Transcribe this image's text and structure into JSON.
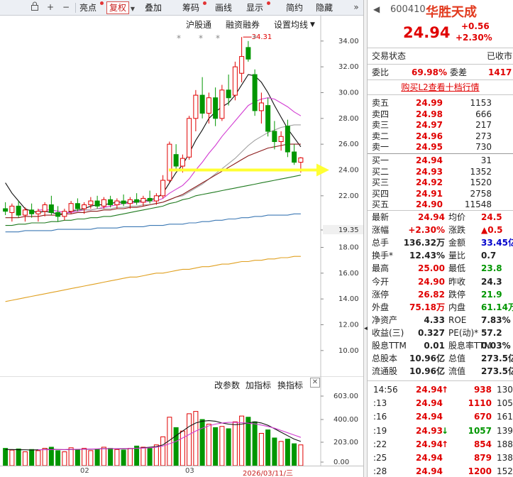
{
  "toolbar": {
    "icons": [
      "lock-icon",
      "plus-icon",
      "minus-icon"
    ],
    "items": [
      {
        "label": "亮点",
        "dot": true,
        "active": false
      },
      {
        "label": "复权",
        "dot": false,
        "active": true
      },
      {
        "label": "叠加",
        "dot": false,
        "active": false
      },
      {
        "label": "筹码",
        "dot": true,
        "active": false
      },
      {
        "label": "画线",
        "dot": false,
        "active": false
      },
      {
        "label": "显示",
        "dot": true,
        "active": false
      },
      {
        "label": "简约",
        "dot": false,
        "active": false
      },
      {
        "label": "隐藏",
        "dot": false,
        "active": false
      }
    ],
    "more_icon": "double-chevron-right-icon"
  },
  "chart_links": {
    "hgt": "沪股通",
    "rzrq": "融资融券",
    "ma_settings": "设置均线"
  },
  "chart_data": [
    {
      "type": "candlestick",
      "title": "",
      "y_ticks": [
        10.0,
        12.0,
        14.0,
        16.0,
        18.0,
        19.35,
        22.0,
        24.0,
        26.0,
        28.0,
        30.0,
        32.0,
        34.0
      ],
      "y_tick_labels": [
        "10.00",
        "12.00",
        "14.00",
        "16.00",
        "18.00",
        "19.35",
        "22.00",
        "24.00",
        "26.00",
        "28.00",
        "30.00",
        "32.00",
        "34.00"
      ],
      "ylim": [
        9.0,
        35.2
      ],
      "high_annotation": "34.31",
      "star_marks": "*",
      "arrow_marker_price": 24.0,
      "candles": [
        {
          "o": 21.0,
          "h": 21.5,
          "l": 20.5,
          "c": 20.8
        },
        {
          "o": 20.7,
          "h": 21.4,
          "l": 20.0,
          "c": 21.2
        },
        {
          "o": 21.2,
          "h": 21.6,
          "l": 20.3,
          "c": 20.5
        },
        {
          "o": 20.5,
          "h": 21.1,
          "l": 20.0,
          "c": 20.9
        },
        {
          "o": 20.9,
          "h": 21.4,
          "l": 20.3,
          "c": 20.6
        },
        {
          "o": 20.6,
          "h": 21.0,
          "l": 20.0,
          "c": 20.8
        },
        {
          "o": 20.8,
          "h": 21.5,
          "l": 20.4,
          "c": 21.3
        },
        {
          "o": 21.3,
          "h": 22.0,
          "l": 20.5,
          "c": 20.7
        },
        {
          "o": 20.7,
          "h": 21.2,
          "l": 20.0,
          "c": 20.4
        },
        {
          "o": 20.4,
          "h": 21.0,
          "l": 20.1,
          "c": 20.8
        },
        {
          "o": 20.8,
          "h": 21.6,
          "l": 20.6,
          "c": 21.4
        },
        {
          "o": 21.4,
          "h": 21.8,
          "l": 20.8,
          "c": 21.0
        },
        {
          "o": 21.0,
          "h": 21.5,
          "l": 20.6,
          "c": 21.3
        },
        {
          "o": 21.3,
          "h": 21.9,
          "l": 21.0,
          "c": 21.6
        },
        {
          "o": 21.6,
          "h": 22.0,
          "l": 21.0,
          "c": 21.2
        },
        {
          "o": 21.2,
          "h": 21.9,
          "l": 21.0,
          "c": 21.7
        },
        {
          "o": 21.7,
          "h": 22.0,
          "l": 21.1,
          "c": 21.3
        },
        {
          "o": 21.3,
          "h": 21.8,
          "l": 21.0,
          "c": 21.6
        },
        {
          "o": 21.6,
          "h": 22.1,
          "l": 21.2,
          "c": 21.4
        },
        {
          "o": 21.4,
          "h": 21.9,
          "l": 21.0,
          "c": 21.7
        },
        {
          "o": 21.7,
          "h": 22.2,
          "l": 21.3,
          "c": 21.5
        },
        {
          "o": 21.5,
          "h": 22.0,
          "l": 21.2,
          "c": 21.8
        },
        {
          "o": 21.8,
          "h": 22.4,
          "l": 21.4,
          "c": 21.6
        },
        {
          "o": 21.6,
          "h": 22.2,
          "l": 21.3,
          "c": 22.0
        },
        {
          "o": 22.0,
          "h": 23.6,
          "l": 21.8,
          "c": 23.2
        },
        {
          "o": 23.2,
          "h": 26.2,
          "l": 23.0,
          "c": 26.0
        },
        {
          "o": 25.2,
          "h": 26.0,
          "l": 24.0,
          "c": 24.3
        },
        {
          "o": 24.3,
          "h": 25.2,
          "l": 23.8,
          "c": 24.9
        },
        {
          "o": 25.0,
          "h": 28.2,
          "l": 24.8,
          "c": 28.0
        },
        {
          "o": 28.0,
          "h": 30.2,
          "l": 27.0,
          "c": 29.8
        },
        {
          "o": 29.8,
          "h": 31.2,
          "l": 28.0,
          "c": 28.4
        },
        {
          "o": 28.4,
          "h": 30.0,
          "l": 27.6,
          "c": 29.6
        },
        {
          "o": 29.6,
          "h": 30.4,
          "l": 27.4,
          "c": 28.0
        },
        {
          "o": 28.0,
          "h": 30.6,
          "l": 27.8,
          "c": 30.2
        },
        {
          "o": 30.2,
          "h": 31.4,
          "l": 29.0,
          "c": 29.6
        },
        {
          "o": 29.8,
          "h": 32.4,
          "l": 29.4,
          "c": 32.0
        },
        {
          "o": 31.5,
          "h": 34.31,
          "l": 30.8,
          "c": 32.8
        },
        {
          "o": 33.5,
          "h": 34.0,
          "l": 32.4,
          "c": 32.6
        },
        {
          "o": 31.4,
          "h": 31.8,
          "l": 28.2,
          "c": 28.6
        },
        {
          "o": 28.6,
          "h": 30.0,
          "l": 27.6,
          "c": 29.2
        },
        {
          "o": 29.0,
          "h": 29.6,
          "l": 26.6,
          "c": 27.0
        },
        {
          "o": 27.0,
          "h": 27.8,
          "l": 25.6,
          "c": 26.2
        },
        {
          "o": 26.2,
          "h": 27.0,
          "l": 25.5,
          "c": 26.6
        },
        {
          "o": 27.4,
          "h": 27.9,
          "l": 25.0,
          "c": 25.4
        },
        {
          "o": 25.4,
          "h": 26.0,
          "l": 24.4,
          "c": 24.6
        },
        {
          "o": 24.6,
          "h": 25.0,
          "l": 23.8,
          "c": 24.94
        }
      ],
      "ma_lines": [
        {
          "color": "#111111",
          "values": [
            23.0,
            22.2,
            21.6,
            21.0,
            20.8,
            20.7,
            20.8,
            20.7,
            20.6,
            20.6,
            20.8,
            20.9,
            21.0,
            21.2,
            21.3,
            21.3,
            21.4,
            21.5,
            21.5,
            21.5,
            21.6,
            21.6,
            21.7,
            21.8,
            22.2,
            23.0,
            23.8,
            24.4,
            25.3,
            26.3,
            27.1,
            28.0,
            28.5,
            28.9,
            29.2,
            29.8,
            30.6,
            31.4,
            31.3,
            30.8,
            30.0,
            29.0,
            28.1,
            27.2,
            26.5,
            25.8
          ]
        },
        {
          "color": "#d23cd2",
          "values": [
            null,
            null,
            null,
            null,
            null,
            20.9,
            20.9,
            20.9,
            20.8,
            20.7,
            20.7,
            20.8,
            20.9,
            20.9,
            21.0,
            21.1,
            21.2,
            21.3,
            21.4,
            21.4,
            21.5,
            21.5,
            21.6,
            21.6,
            21.8,
            22.2,
            22.5,
            22.8,
            23.3,
            24.0,
            24.6,
            25.3,
            25.9,
            26.6,
            27.2,
            27.8,
            28.4,
            29.0,
            29.3,
            29.5,
            29.6,
            29.5,
            29.2,
            28.9,
            28.5,
            28.2
          ]
        },
        {
          "color": "#a0a0a0",
          "values": [
            null,
            null,
            null,
            null,
            null,
            null,
            null,
            null,
            null,
            null,
            20.9,
            20.9,
            20.9,
            20.9,
            21.0,
            21.0,
            21.0,
            21.1,
            21.1,
            21.2,
            21.2,
            21.3,
            21.3,
            21.4,
            21.5,
            21.7,
            21.9,
            22.0,
            22.3,
            22.6,
            22.9,
            23.3,
            23.7,
            24.1,
            24.5,
            24.9,
            25.4,
            25.9,
            26.3,
            26.6,
            26.9,
            27.1,
            27.3,
            27.4,
            27.5,
            27.5
          ]
        },
        {
          "color": "#8b1a1a",
          "values": [
            20.3,
            20.3,
            20.3,
            20.4,
            20.4,
            20.4,
            20.5,
            20.5,
            20.5,
            20.6,
            20.6,
            20.7,
            20.7,
            20.8,
            20.8,
            20.9,
            20.9,
            21.0,
            21.0,
            21.1,
            21.1,
            21.2,
            21.3,
            21.4,
            21.5,
            21.7,
            21.9,
            22.1,
            22.4,
            22.7,
            23.0,
            23.3,
            23.6,
            23.9,
            24.2,
            24.5,
            24.8,
            25.1,
            25.3,
            25.5,
            25.7,
            25.8,
            25.9,
            26.0,
            26.0,
            26.0
          ]
        },
        {
          "color": "#1f7a1f",
          "values": [
            19.7,
            19.7,
            19.8,
            19.8,
            19.9,
            19.9,
            19.9,
            20.0,
            20.0,
            20.1,
            20.1,
            20.2,
            20.2,
            20.3,
            20.3,
            20.4,
            20.4,
            20.5,
            20.6,
            20.7,
            20.8,
            20.9,
            21.0,
            21.1,
            21.2,
            21.4,
            21.5,
            21.7,
            21.8,
            22.0,
            22.1,
            22.2,
            22.3,
            22.4,
            22.5,
            22.6,
            22.7,
            22.8,
            22.9,
            23.0,
            23.1,
            23.2,
            23.3,
            23.4,
            23.5,
            23.6
          ]
        },
        {
          "color": "#3c78b4",
          "values": [
            19.2,
            19.2,
            19.2,
            19.3,
            19.3,
            19.3,
            19.3,
            19.3,
            19.4,
            19.4,
            19.4,
            19.4,
            19.4,
            19.4,
            19.5,
            19.5,
            19.5,
            19.5,
            19.6,
            19.6,
            19.6,
            19.6,
            19.7,
            19.7,
            19.7,
            19.8,
            19.8,
            19.8,
            19.9,
            19.9,
            20.0,
            20.0,
            20.1,
            20.1,
            20.2,
            20.2,
            20.3,
            20.3,
            20.4,
            20.4,
            20.5,
            20.5,
            20.5,
            20.5,
            20.6,
            20.6
          ]
        },
        {
          "color": "#e0a020",
          "values": [
            13.8,
            13.9,
            14.0,
            14.1,
            14.2,
            14.3,
            14.4,
            14.5,
            14.6,
            14.7,
            14.8,
            14.9,
            15.0,
            15.1,
            15.2,
            15.3,
            15.4,
            15.5,
            15.6,
            15.7,
            15.7,
            15.8,
            15.9,
            16.0,
            16.0,
            16.1,
            16.2,
            16.3,
            16.3,
            16.4,
            16.5,
            16.5,
            16.6,
            16.7,
            16.7,
            16.8,
            16.9,
            16.9,
            17.0,
            17.0,
            17.1,
            17.1,
            17.2,
            17.2,
            17.3,
            17.3
          ]
        }
      ]
    },
    {
      "type": "bar",
      "title": "",
      "y_tick_labels": [
        "603.00",
        "400.00",
        "203.00",
        "0.00"
      ],
      "y_ticks": [
        603,
        400,
        203,
        0
      ],
      "ylim": [
        0,
        640
      ],
      "values": [
        150,
        135,
        145,
        120,
        140,
        130,
        150,
        160,
        130,
        120,
        155,
        140,
        150,
        130,
        145,
        160,
        150,
        140,
        135,
        150,
        170,
        160,
        150,
        180,
        250,
        420,
        330,
        300,
        450,
        470,
        400,
        360,
        330,
        340,
        320,
        380,
        430,
        420,
        380,
        280,
        310,
        240,
        210,
        230,
        190,
        180
      ],
      "ma_lines": [
        {
          "color": "#111111",
          "values": [
            140,
            140,
            138,
            137,
            136,
            137,
            140,
            142,
            140,
            138,
            140,
            141,
            142,
            143,
            144,
            147,
            148,
            146,
            145,
            147,
            150,
            155,
            160,
            165,
            180,
            220,
            260,
            300,
            340,
            370,
            385,
            390,
            385,
            370,
            360,
            355,
            360,
            370,
            380,
            370,
            350,
            320,
            290,
            260,
            230,
            210
          ]
        },
        {
          "color": "#d23cd2",
          "values": [
            null,
            null,
            null,
            null,
            null,
            138,
            138,
            139,
            140,
            140,
            141,
            142,
            143,
            144,
            145,
            146,
            147,
            147,
            148,
            149,
            150,
            152,
            155,
            160,
            170,
            190,
            210,
            240,
            270,
            300,
            325,
            345,
            360,
            370,
            375,
            375,
            372,
            368,
            362,
            352,
            340,
            325,
            305,
            285,
            265,
            245
          ]
        }
      ],
      "indicator_buttons": [
        "改参数",
        "加指标",
        "换指标"
      ]
    }
  ],
  "x_axis": {
    "labels": [
      "02",
      "03",
      "2026/03/11/三"
    ]
  },
  "quote": {
    "code": "600410",
    "name": "华胜天成",
    "price": "24.94",
    "change": "+0.56",
    "change_pct": "+2.30%",
    "status_label": "交易状态",
    "status_value": "已收市",
    "weibi_label": "委比",
    "weibi_value": "69.98%",
    "weicha_label": "委差",
    "weicha_value": "1417",
    "l2_link": "购买L2查看十档行情",
    "asks": [
      {
        "label": "卖五",
        "price": "24.99",
        "vol": "1153"
      },
      {
        "label": "卖四",
        "price": "24.98",
        "vol": "666"
      },
      {
        "label": "卖三",
        "price": "24.97",
        "vol": "217"
      },
      {
        "label": "卖二",
        "price": "24.96",
        "vol": "273"
      },
      {
        "label": "卖一",
        "price": "24.95",
        "vol": "730"
      }
    ],
    "bids": [
      {
        "label": "买一",
        "price": "24.94",
        "vol": "31"
      },
      {
        "label": "买二",
        "price": "24.93",
        "vol": "1352"
      },
      {
        "label": "买三",
        "price": "24.92",
        "vol": "1520"
      },
      {
        "label": "买四",
        "price": "24.91",
        "vol": "2758"
      },
      {
        "label": "买五",
        "price": "24.90",
        "vol": "11548"
      }
    ],
    "stats": [
      {
        "l1": "最新",
        "v1": "24.94",
        "c1": "red",
        "l2": "均价",
        "v2": "24.5",
        "c2": "red"
      },
      {
        "l1": "涨幅",
        "v1": "+2.30%",
        "c1": "red",
        "l2": "涨跌",
        "v2": "▲0.5",
        "c2": "red"
      },
      {
        "l1": "总手",
        "v1": "136.32万",
        "c1": "black",
        "l2": "金额",
        "v2": "33.45亿",
        "c2": "blue"
      },
      {
        "l1": "换手*",
        "v1": "12.43%",
        "c1": "black",
        "l2": "量比",
        "v2": "0.7",
        "c2": "black"
      },
      {
        "l1": "最高",
        "v1": "25.00",
        "c1": "red",
        "l2": "最低",
        "v2": "23.8",
        "c2": "green"
      },
      {
        "l1": "今开",
        "v1": "24.90",
        "c1": "red",
        "l2": "昨收",
        "v2": "24.3",
        "c2": "black"
      },
      {
        "l1": "涨停",
        "v1": "26.82",
        "c1": "red",
        "l2": "跌停",
        "v2": "21.9",
        "c2": "green"
      },
      {
        "l1": "外盘",
        "v1": "75.18万",
        "c1": "red",
        "l2": "内盘",
        "v2": "61.14万",
        "c2": "green"
      },
      {
        "l1": "净资产",
        "v1": "4.33",
        "c1": "black",
        "l2": "ROE",
        "v2": "7.83%",
        "c2": "black"
      },
      {
        "l1": "收益(三)",
        "v1": "0.327",
        "c1": "black",
        "l2": "PE(动)*",
        "v2": "57.2",
        "c2": "black"
      },
      {
        "l1": "股息TTM",
        "v1": "0.01",
        "c1": "black",
        "l2": "股息率TTM",
        "v2": "0.03%",
        "c2": "black"
      },
      {
        "l1": "总股本",
        "v1": "10.96亿",
        "c1": "black",
        "l2": "总值",
        "v2": "273.5亿",
        "c2": "black"
      },
      {
        "l1": "流通股",
        "v1": "10.96亿",
        "c1": "black",
        "l2": "流值",
        "v2": "273.5亿",
        "c2": "black"
      }
    ],
    "ticks": [
      {
        "time": "14:56",
        "price": "24.94",
        "dir": "up",
        "vol": "938",
        "num": "130"
      },
      {
        "time": ":13",
        "price": "24.94",
        "dir": "",
        "vol": "1110",
        "num": "105"
      },
      {
        "time": ":16",
        "price": "24.94",
        "dir": "",
        "vol": "670",
        "num": "161"
      },
      {
        "time": ":19",
        "price": "24.93",
        "dir": "down",
        "vol": "1057",
        "num": "139"
      },
      {
        "time": ":22",
        "price": "24.94",
        "dir": "up",
        "vol": "854",
        "num": "188"
      },
      {
        "time": ":25",
        "price": "24.94",
        "dir": "",
        "vol": "879",
        "num": "138"
      },
      {
        "time": ":28",
        "price": "24.94",
        "dir": "",
        "vol": "1200",
        "num": "152"
      }
    ]
  },
  "colors": {
    "up": "#e00000",
    "down": "#009600",
    "arrow": "#ffff33",
    "accent": "#c81e1e"
  }
}
